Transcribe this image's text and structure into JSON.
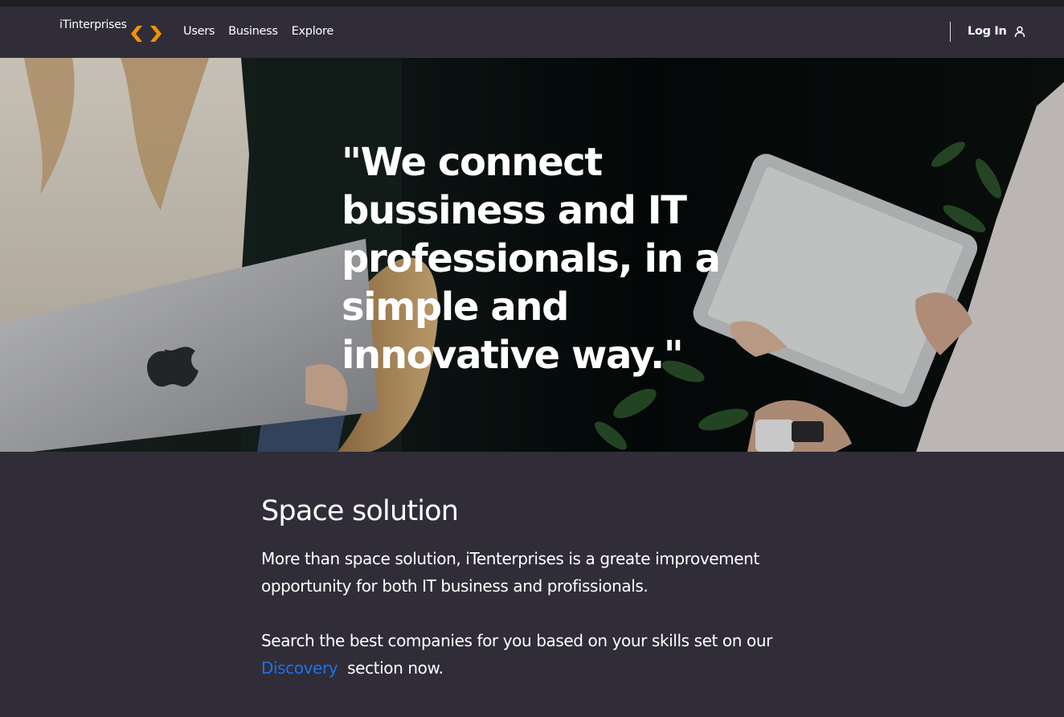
{
  "navbar": {
    "brand": "iTinterprises",
    "links": [
      "Users",
      "Business",
      "Explore"
    ],
    "login_label": "Log In"
  },
  "hero": {
    "quote": "\"We connect bussiness and IT professionals, in a simple and innovative way.\""
  },
  "section": {
    "title": "Space solution",
    "paragraph1": "More than space solution, iTenterprises is a greate improvement opportunity for both IT business and profissionals.",
    "paragraph2_before": "Search the best companies for you based on your skills set on our",
    "paragraph2_link": "Discovery",
    "paragraph2_after": "section now."
  },
  "colors": {
    "background": "#302d38",
    "accent_logo": "#f39200",
    "link": "#1a73e8"
  },
  "icons": {
    "brand": "code-arrows-icon",
    "login": "user-icon"
  }
}
